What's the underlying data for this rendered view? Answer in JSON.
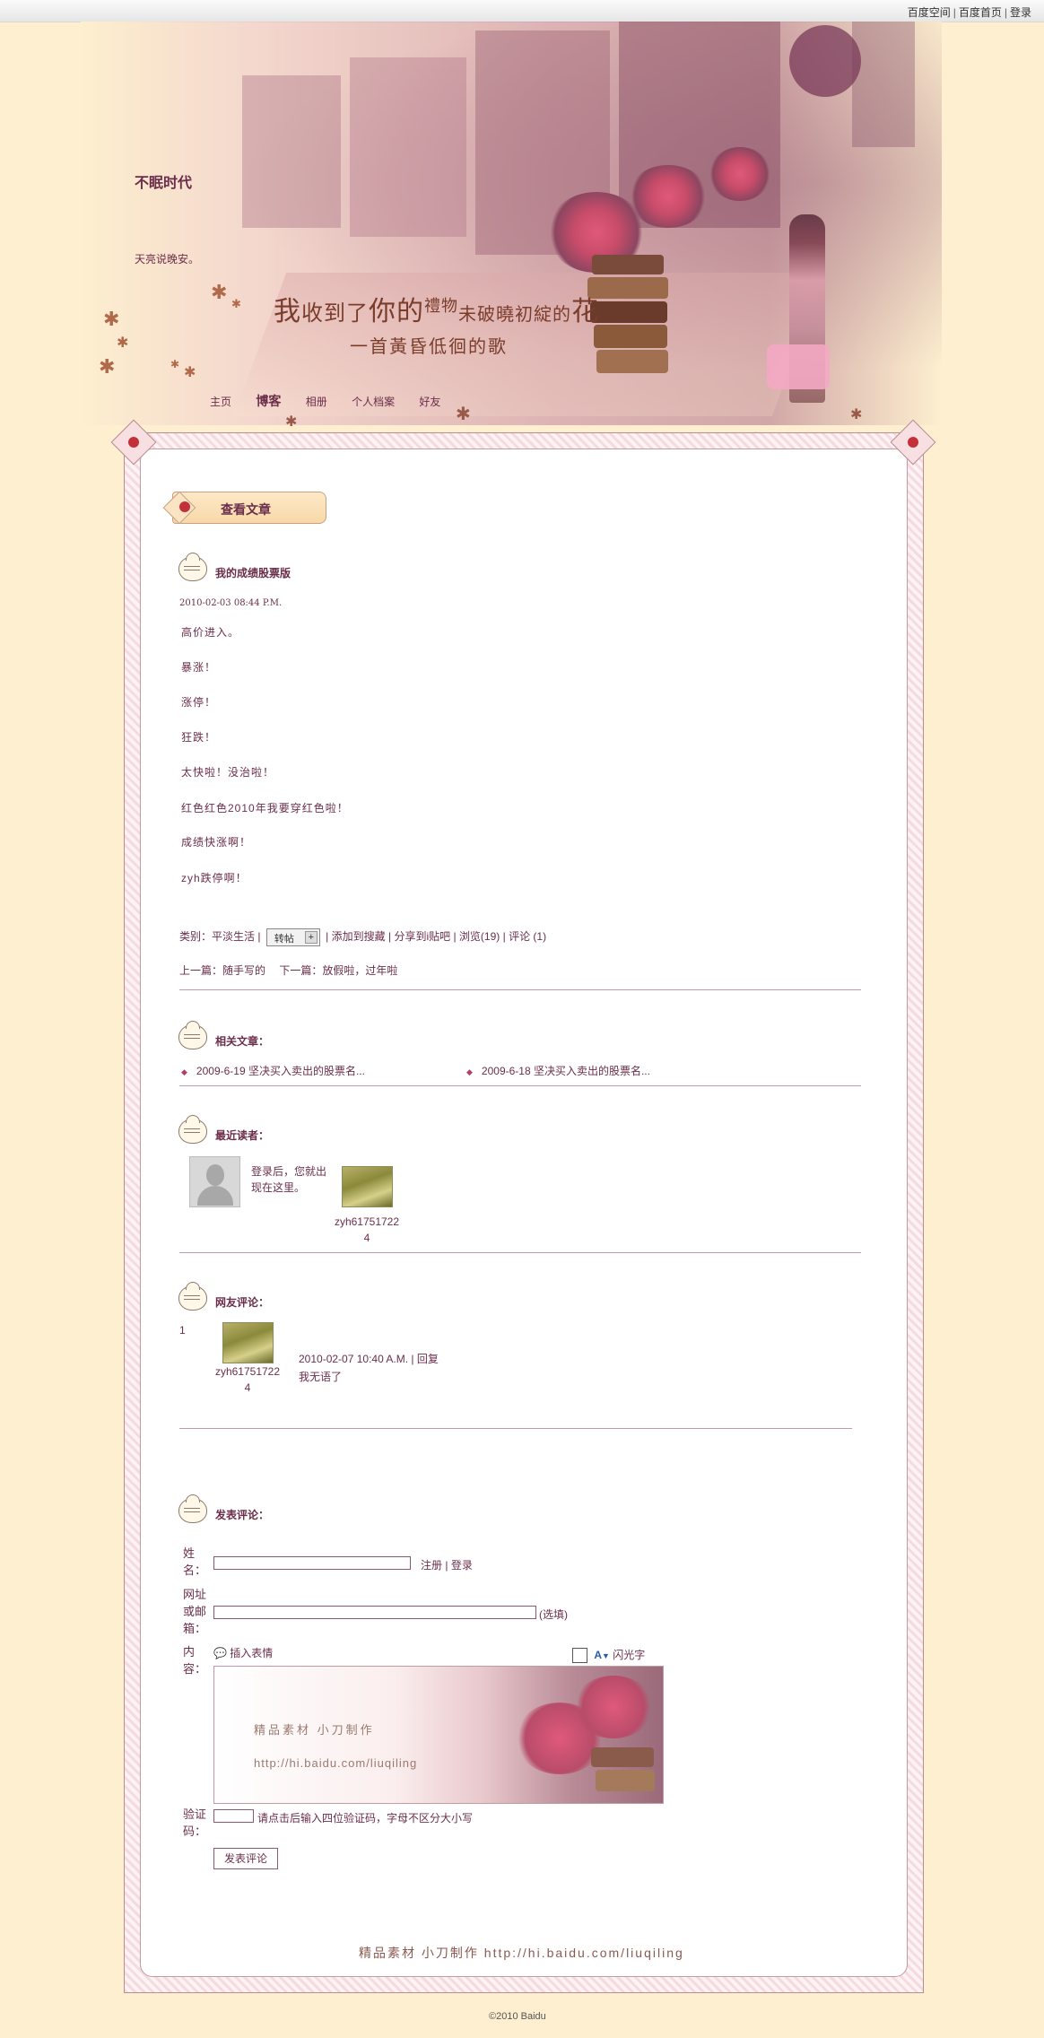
{
  "topbar": {
    "links": [
      "百度空间",
      "百度首页",
      "登录"
    ],
    "separator": "|"
  },
  "blog": {
    "title": "不眠时代",
    "description": "天亮说晚安。",
    "poem_line1_big1": "我",
    "poem_line1_a": "收到了",
    "poem_line1_big2": "你的",
    "poem_line1_b": "禮物",
    "poem_line1_c": "未破曉初綻的",
    "poem_line1_big3": "花",
    "poem_line2": "一首黃昏低徊的歌"
  },
  "nav": {
    "items": [
      "主页",
      "博客",
      "相册",
      "个人档案",
      "好友"
    ],
    "active": "博客"
  },
  "view_tag": "查看文章",
  "article": {
    "title": "我的成绩股票版",
    "date": "2010-02-03 08:44 P.M.",
    "lines": [
      "高价进入。",
      "暴涨！",
      "涨停！",
      "狂跌！",
      "太快啦！没治啦！",
      "红色红色2010年我要穿红色啦！",
      "成绩快涨啊！",
      "zyh跌停啊！"
    ],
    "meta": {
      "category_label": "类别：",
      "category": "平淡生活",
      "repost": "转帖",
      "add_favorite": "添加到搜藏",
      "share": "分享到i贴吧",
      "views": "浏览(19)",
      "comments": "评论 (1)"
    },
    "prev_label": "上一篇：",
    "prev": "随手写的",
    "next_label": "下一篇：",
    "next": "放假啦，过年啦"
  },
  "related": {
    "title": "相关文章：",
    "items": [
      "2009-6-19 坚决买入卖出的股票名...",
      "2009-6-18 坚决买入卖出的股票名..."
    ]
  },
  "readers": {
    "title": "最近读者：",
    "login_hint": "登录后，您就出现在这里。",
    "login_hint_l1": "登录后，您就出",
    "login_hint_l2": "现在这里。",
    "reader_name_l1": "zyh61751722",
    "reader_name_l2": "4"
  },
  "comments": {
    "title": "网友评论：",
    "items": [
      {
        "index": "1",
        "name_l1": "zyh61751722",
        "name_l2": "4",
        "time": "2010-02-07 10:40 A.M.",
        "reply": "回复",
        "text": "我无语了"
      }
    ]
  },
  "post_comment": {
    "title": "发表评论：",
    "name_label": "姓名：",
    "register": "注册",
    "login": "登录",
    "url_label": "网址或邮箱：",
    "optional": "(选填)",
    "content_label": "内容：",
    "insert_emoticon": "插入表情",
    "flash_text": "闪光字",
    "captcha_label": "验证码：",
    "captcha_hint": "请点击后输入四位验证码，字母不区分大小写",
    "submit": "发表评论",
    "bg_text1": "精品素材  小刀制作",
    "bg_text2": "http://hi.baidu.com/liuqiling"
  },
  "footer": {
    "signature": "精品素材  小刀制作   http://hi.baidu.com/liuqiling",
    "copyright": "©2010 Baidu"
  },
  "colors": {
    "background": "#fdefcf",
    "text": "#6b2e4a",
    "accent": "#c4303a",
    "line": "#c59aa0"
  }
}
